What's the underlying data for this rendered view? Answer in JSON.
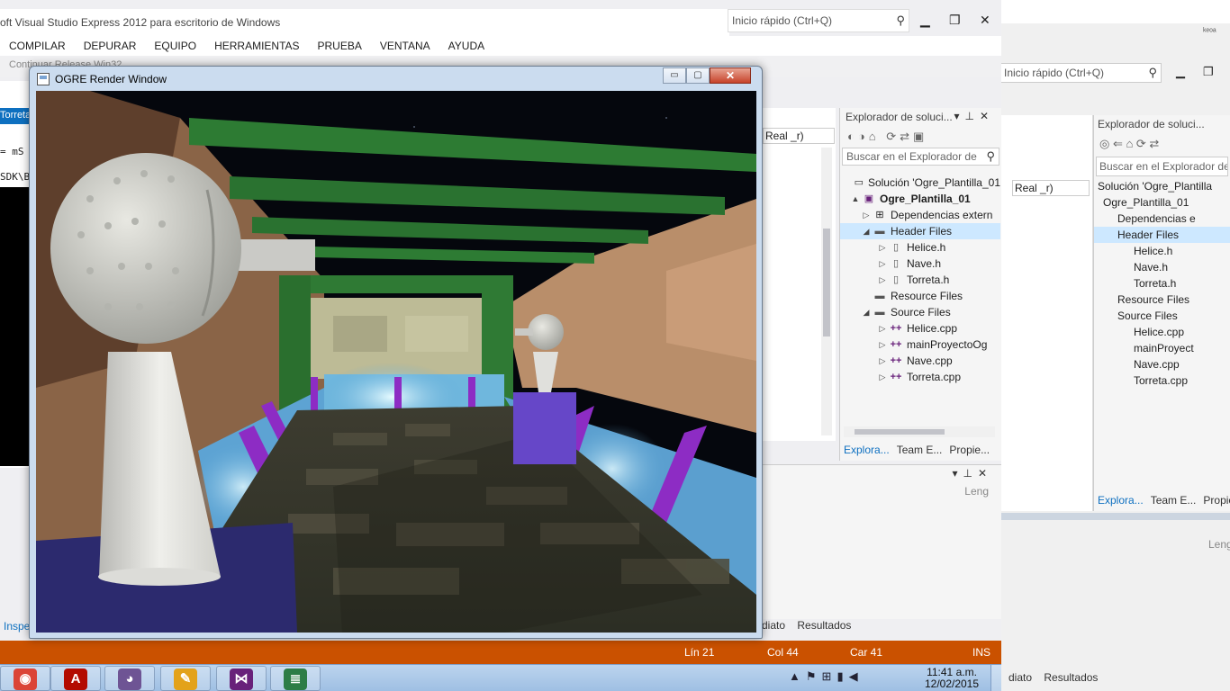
{
  "bg_window": {
    "quick_launch": "Inicio rápido (Ctrl+Q)",
    "corner_text": "ᵏᵉᵒᵃ",
    "real_text": "Real _r)",
    "solution_header": "Explorador de soluci...",
    "search_placeholder": "Buscar en el Explorador de",
    "tree": [
      {
        "label": "Solución 'Ogre_Plantilla"
      },
      {
        "label": "Ogre_Plantilla_01"
      },
      {
        "label": "Dependencias e"
      },
      {
        "label": "Header Files"
      },
      {
        "label": "Helice.h"
      },
      {
        "label": "Nave.h"
      },
      {
        "label": "Torreta.h"
      },
      {
        "label": "Resource Files"
      },
      {
        "label": "Source Files"
      },
      {
        "label": "Helice.cpp"
      },
      {
        "label": "mainProyect"
      },
      {
        "label": "Nave.cpp"
      },
      {
        "label": "Torreta.cpp"
      }
    ],
    "tabs": [
      "Explora...",
      "Team E...",
      "Propie"
    ],
    "leng": "Leng",
    "bottom_tabs": [
      "diato",
      "Resultados"
    ]
  },
  "vs": {
    "title": "oft Visual Studio Express 2012 para escritorio de Windows",
    "quick_launch": "Inicio rápido (Ctrl+Q)",
    "menu": [
      "COMPILAR",
      "DEPURAR",
      "EQUIPO",
      "HERRAMIENTAS",
      "PRUEBA",
      "VENTANA",
      "AYUDA"
    ],
    "toolbar_text": "Continuar   Release   Win32",
    "editor_tab": "Torreta.c",
    "code_line_1": "= mS",
    "code_line_2": "SDK\\Bi",
    "real_text": "Real _r)",
    "inspector_link": "Inspe",
    "bottom_leng": "Leng",
    "bottom_tabs": [
      "diato",
      "Resultados"
    ],
    "solution": {
      "header": "Explorador de soluci...",
      "search_placeholder": "Buscar en el Explorador de",
      "tree": [
        {
          "label": "Solución 'Ogre_Plantilla_01",
          "icon": "solution-icon",
          "arrow": ""
        },
        {
          "label": "Ogre_Plantilla_01",
          "icon": "project-icon",
          "arrow": "▲",
          "bold": true
        },
        {
          "label": "Dependencias extern",
          "icon": "dependencies-icon",
          "arrow": "▷"
        },
        {
          "label": "Header Files",
          "icon": "folder-icon",
          "arrow": "◢",
          "selected": true
        },
        {
          "label": "Helice.h",
          "icon": "header-file-icon",
          "arrow": "▷"
        },
        {
          "label": "Nave.h",
          "icon": "header-file-icon",
          "arrow": "▷"
        },
        {
          "label": "Torreta.h",
          "icon": "header-file-icon",
          "arrow": "▷"
        },
        {
          "label": "Resource Files",
          "icon": "folder-icon",
          "arrow": ""
        },
        {
          "label": "Source Files",
          "icon": "folder-icon",
          "arrow": "◢"
        },
        {
          "label": "Helice.cpp",
          "icon": "cpp-file-icon",
          "arrow": "▷"
        },
        {
          "label": "mainProyectoOg",
          "icon": "cpp-file-icon",
          "arrow": "▷"
        },
        {
          "label": "Nave.cpp",
          "icon": "cpp-file-icon",
          "arrow": "▷"
        },
        {
          "label": "Torreta.cpp",
          "icon": "cpp-file-icon",
          "arrow": "▷"
        }
      ],
      "tabs": [
        "Explora...",
        "Team E...",
        "Propie..."
      ]
    },
    "status": {
      "line": "Lín 21",
      "col": "Col 44",
      "car": "Car 41",
      "mode": "INS"
    },
    "accent": "#0e70c0",
    "status_color": "#ca5100"
  },
  "ogre": {
    "title": "OGRE Render Window",
    "min_glyph": "▭",
    "max_glyph": "▢",
    "close_glyph": "✕"
  },
  "taskbar": {
    "apps": [
      {
        "name": "chrome-icon",
        "glyph": "◉",
        "color": "#db4437"
      },
      {
        "name": "acrobat-icon",
        "glyph": "A",
        "color": "#b30b00"
      },
      {
        "name": "github-icon",
        "glyph": "◕",
        "color": "#6e5494"
      },
      {
        "name": "paint-icon",
        "glyph": "✎",
        "color": "#e3a21a"
      },
      {
        "name": "visual-studio-icon",
        "glyph": "⋈",
        "color": "#68217a"
      },
      {
        "name": "notepad-icon",
        "glyph": "≣",
        "color": "#2d7d46"
      }
    ],
    "clock_time": "11:41 a.m.",
    "clock_date": "12/02/2015"
  }
}
